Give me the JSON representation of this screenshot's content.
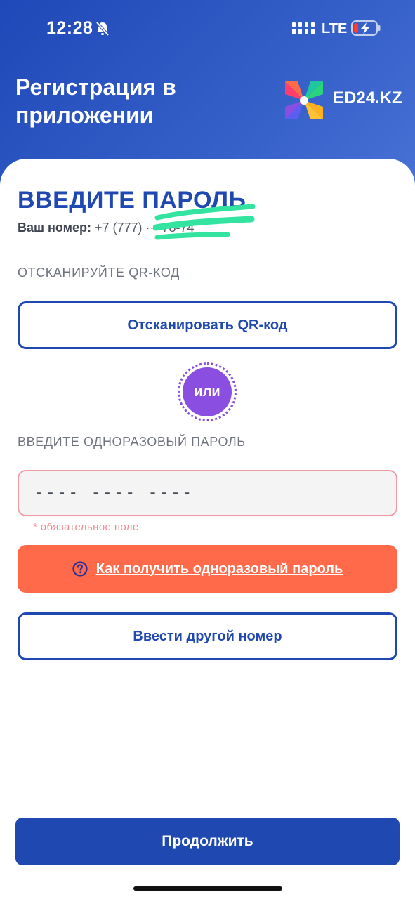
{
  "status_bar": {
    "time": "12:28",
    "network": "LTE"
  },
  "header": {
    "title": "Регистрация в приложении",
    "logo_text": "ED24.KZ"
  },
  "form": {
    "heading": "ВВЕДИТЕ ПАРОЛЬ",
    "phone_label": "Ваш номер:",
    "phone_value": "+7 (777) ··· 78-74",
    "qr_section_label": "ОТСКАНИРУЙТЕ QR-КОД",
    "scan_button_label": "Отсканировать QR-код",
    "or_label": "или",
    "otp_section_label": "ВВЕДИТЕ ОДНОРАЗОВЫЙ ПАРОЛЬ",
    "otp_placeholder": "---- ---- ----",
    "otp_value": "",
    "required_note": "* обязательное поле",
    "help_link_label": "Как получить одноразовый пароль",
    "other_number_button_label": "Ввести другой номер",
    "continue_button_label": "Продолжить"
  },
  "colors": {
    "primary": "#1f48b0",
    "accent_orange": "#ff6b4a",
    "or_purple": "#8a4fe0",
    "error_pink": "#f08a92",
    "redaction_green": "#33e3a0"
  },
  "icons": {
    "status_bell": "bell-slash-icon",
    "status_signal": "signal-bars-icon",
    "status_battery": "battery-charging-icon",
    "help": "question-circle-icon",
    "logo": "pinwheel-logo-icon"
  }
}
